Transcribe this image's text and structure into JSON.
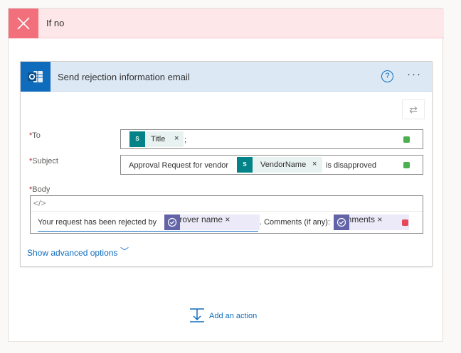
{
  "branch": {
    "title": "If no",
    "colors": {
      "header_bg": "#fde7e9",
      "close_bg": "#f1707b"
    }
  },
  "action_card": {
    "title": "Send rejection information email",
    "help_icon": "?",
    "more_icon": "···",
    "swap_icon": "⇄",
    "colors": {
      "header_bg": "#dce9f5",
      "accent": "#0f6cbd"
    }
  },
  "fields": {
    "to": {
      "required_mark": "*",
      "label": "To",
      "tokens": [
        {
          "icon": "sharepoint-icon",
          "icon_text": "S",
          "label": "Title",
          "close": "×"
        }
      ],
      "suffix": ";",
      "status_color": "#4caf50"
    },
    "subject": {
      "required_mark": "*",
      "label": "Subject",
      "prefix": "Approval Request for vendor",
      "tokens": [
        {
          "icon": "sharepoint-icon",
          "icon_text": "S",
          "label": "VendorName",
          "close": "×"
        }
      ],
      "suffix": "is disapproved",
      "status_color": "#4caf50"
    },
    "body": {
      "required_mark": "*",
      "label": "Body",
      "code_toggle": "</>",
      "prefix": "Your request has been rejected by",
      "tokens": [
        {
          "icon": "approvals-icon",
          "label": "Approver name",
          "close": "×"
        },
        {
          "icon": "approvals-icon",
          "label": "Comments",
          "close": "×"
        }
      ],
      "middle": ". Comments (if any):",
      "status_color": "#e74856"
    }
  },
  "advanced": {
    "label": "Show advanced options",
    "chevron": "﹀"
  },
  "add_action": {
    "label": "Add an action"
  }
}
